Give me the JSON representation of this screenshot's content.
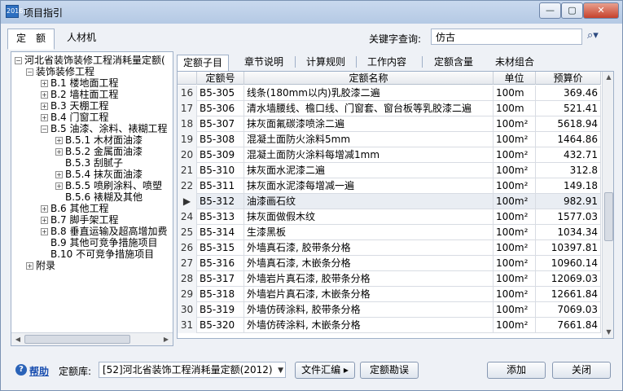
{
  "window": {
    "title": "项目指引",
    "icon": "app-2016-icon",
    "controls": {
      "minimize": "—",
      "maximize": "▢",
      "close": "✕"
    }
  },
  "top_tabs": [
    {
      "label": "定　额",
      "active": true
    },
    {
      "label": "人材机",
      "active": false
    }
  ],
  "search": {
    "label": "关键字查询:",
    "value": "仿古",
    "icon": "binoculars-icon",
    "icon_glyph": "⌕▾"
  },
  "tree": {
    "items": [
      {
        "label": "河北省装饰装修工程消耗量定额(",
        "expander": "−",
        "level": 0
      },
      {
        "label": "装饰装修工程",
        "expander": "−",
        "level": 1
      },
      {
        "label": "B.1 楼地面工程",
        "expander": "+",
        "level": 2
      },
      {
        "label": "B.2 墙柱面工程",
        "expander": "+",
        "level": 2
      },
      {
        "label": "B.3 天棚工程",
        "expander": "+",
        "level": 2
      },
      {
        "label": "B.4 门窗工程",
        "expander": "+",
        "level": 2
      },
      {
        "label": "B.5 油漆、涂料、裱糊工程",
        "expander": "−",
        "level": 2
      },
      {
        "label": "B.5.1 木材面油漆",
        "expander": "+",
        "level": 3
      },
      {
        "label": "B.5.2 金属面油漆",
        "expander": "+",
        "level": 3
      },
      {
        "label": "B.5.3 刮腻子",
        "expander": "",
        "level": 3
      },
      {
        "label": "B.5.4 抹灰面油漆",
        "expander": "+",
        "level": 3
      },
      {
        "label": "B.5.5 喷刷涂料、喷塑",
        "expander": "+",
        "level": 3
      },
      {
        "label": "B.5.6 裱糊及其他",
        "expander": "",
        "level": 3
      },
      {
        "label": "B.6 其他工程",
        "expander": "+",
        "level": 2
      },
      {
        "label": "B.7 脚手架工程",
        "expander": "+",
        "level": 2
      },
      {
        "label": "B.8 垂直运输及超高增加费",
        "expander": "+",
        "level": 2
      },
      {
        "label": "B.9 其他可竞争措施项目",
        "expander": "",
        "level": 2
      },
      {
        "label": "B.10 不可竞争措施项目",
        "expander": "",
        "level": 2
      },
      {
        "label": "附录",
        "expander": "+",
        "level": 1
      }
    ]
  },
  "right_tabs": [
    {
      "label": "定额子目",
      "active": true
    },
    {
      "label": "章节说明",
      "active": false
    },
    {
      "label": "计算规则",
      "active": false
    },
    {
      "label": "工作内容",
      "active": false
    },
    {
      "label": "定额含量",
      "active": false
    },
    {
      "label": "未材组合",
      "active": false
    }
  ],
  "grid": {
    "columns": [
      "",
      "定额号",
      "定额名称",
      "单位",
      "预算价"
    ],
    "selected_row_index": 7,
    "rows": [
      {
        "num": "16",
        "code": "B5-305",
        "name": "线条(180mm以内)乳胶漆二遍",
        "unit": "100m",
        "price": "369.46"
      },
      {
        "num": "17",
        "code": "B5-306",
        "name": "清水墙腰线、檐口线、门窗套、窗台板等乳胶漆二遍",
        "unit": "100m",
        "price": "521.41"
      },
      {
        "num": "18",
        "code": "B5-307",
        "name": "抹灰面氟碳漆喷涂二遍",
        "unit": "100m²",
        "price": "5618.94"
      },
      {
        "num": "19",
        "code": "B5-308",
        "name": "混凝土面防火涂料5mm",
        "unit": "100m²",
        "price": "1464.86"
      },
      {
        "num": "20",
        "code": "B5-309",
        "name": "混凝土面防火涂料每增减1mm",
        "unit": "100m²",
        "price": "432.71"
      },
      {
        "num": "21",
        "code": "B5-310",
        "name": "抹灰面水泥漆二遍",
        "unit": "100m²",
        "price": "312.8"
      },
      {
        "num": "22",
        "code": "B5-311",
        "name": "抹灰面水泥漆每增减一遍",
        "unit": "100m²",
        "price": "149.18"
      },
      {
        "num": "",
        "code": "B5-312",
        "name": "油漆画石纹",
        "unit": "100m²",
        "price": "982.91"
      },
      {
        "num": "24",
        "code": "B5-313",
        "name": "抹灰面做假木纹",
        "unit": "100m²",
        "price": "1577.03"
      },
      {
        "num": "25",
        "code": "B5-314",
        "name": "生漆黑板",
        "unit": "100m²",
        "price": "1034.34"
      },
      {
        "num": "26",
        "code": "B5-315",
        "name": "外墙真石漆, 胶带条分格",
        "unit": "100m²",
        "price": "10397.81"
      },
      {
        "num": "27",
        "code": "B5-316",
        "name": "外墙真石漆, 木嵌条分格",
        "unit": "100m²",
        "price": "10960.14"
      },
      {
        "num": "28",
        "code": "B5-317",
        "name": "外墙岩片真石漆, 胶带条分格",
        "unit": "100m²",
        "price": "12069.03"
      },
      {
        "num": "29",
        "code": "B5-318",
        "name": "外墙岩片真石漆, 木嵌条分格",
        "unit": "100m²",
        "price": "12661.84"
      },
      {
        "num": "30",
        "code": "B5-319",
        "name": "外墙仿砖涂料, 胶带条分格",
        "unit": "100m²",
        "price": "7069.03"
      },
      {
        "num": "31",
        "code": "B5-320",
        "name": "外墙仿砖涂料, 木嵌条分格",
        "unit": "100m²",
        "price": "7661.84"
      }
    ]
  },
  "bottom": {
    "help_icon_glyph": "?",
    "help_label": "帮助",
    "library_label": "定额库:",
    "library_value": "[52]河北省装饰工程消耗量定额(2012)",
    "library_arrow": "▼",
    "buttons": {
      "file_summary": "文件汇编 ▸",
      "errata": "定额勘误",
      "add": "添加",
      "close": "关闭"
    }
  },
  "colors": {
    "accent": "#2a63b8",
    "selection": "#e9edf3",
    "border": "#9fb0c8"
  }
}
